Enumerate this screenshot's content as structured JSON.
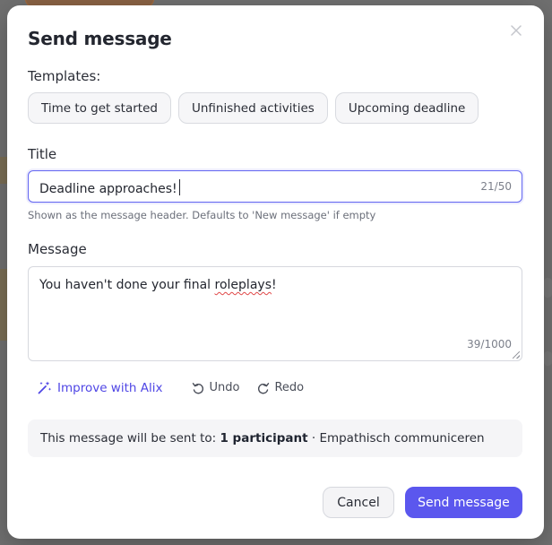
{
  "modal": {
    "title": "Send message",
    "close_icon": "close-icon"
  },
  "templates": {
    "label": "Templates:",
    "items": [
      "Time to get started",
      "Unfinished activities",
      "Upcoming deadline"
    ]
  },
  "title_field": {
    "label": "Title",
    "value": "Deadline approaches!",
    "counter": "21/50",
    "hint": "Shown as the message header. Defaults to 'New message' if empty"
  },
  "message_field": {
    "label": "Message",
    "value_prefix": "You haven't done your final ",
    "value_misspelled": "roleplays",
    "value_suffix": "!",
    "counter": "39/1000"
  },
  "tools": {
    "improve": "Improve with Alix",
    "improve_icon": "magic-wand-icon",
    "undo": "Undo",
    "undo_icon": "undo-icon",
    "redo": "Redo",
    "redo_icon": "redo-icon"
  },
  "recipients": {
    "prefix": "This message will be sent to:",
    "count": "1 participant",
    "separator": "·",
    "group": "Empathisch communiceren"
  },
  "footer": {
    "cancel": "Cancel",
    "send": "Send message"
  },
  "colors": {
    "accent": "#5b57ee",
    "focus_border": "#6366f1",
    "link": "#4f46e5"
  }
}
